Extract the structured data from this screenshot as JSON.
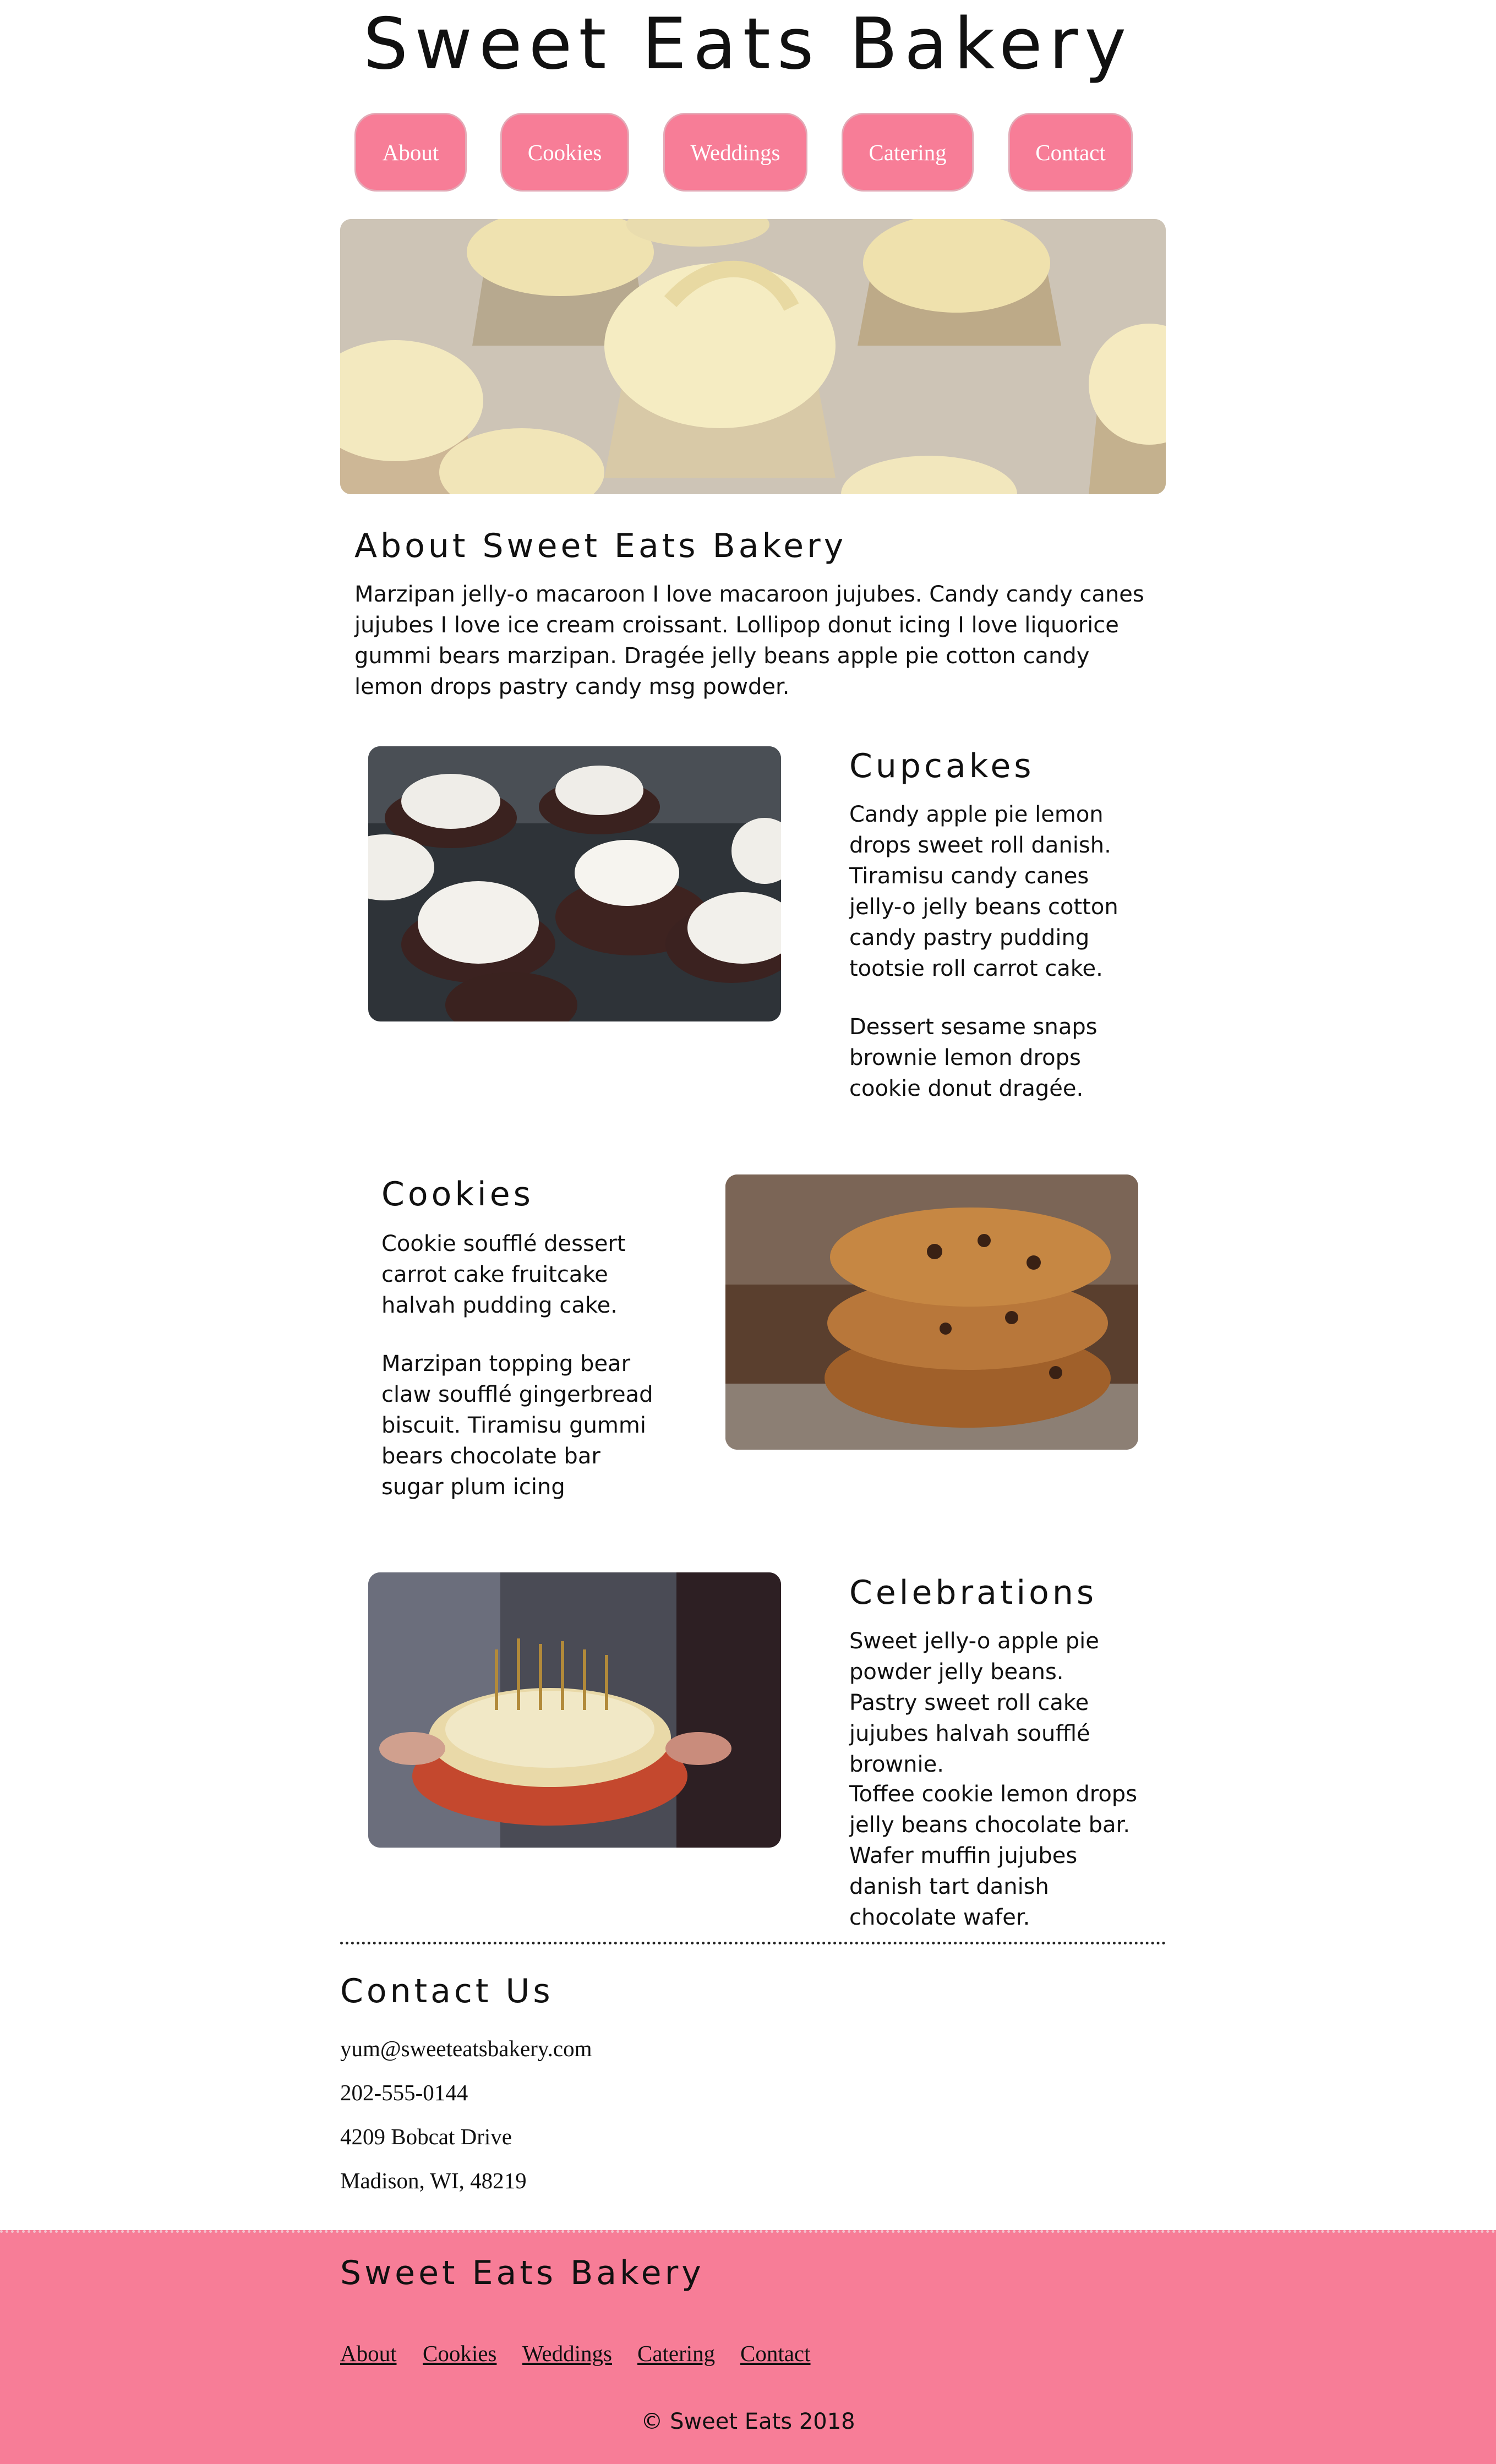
{
  "header": {
    "title": "Sweet Eats Bakery"
  },
  "nav": {
    "items": [
      "About",
      "Cookies",
      "Weddings",
      "Catering",
      "Contact"
    ]
  },
  "about": {
    "title": "About Sweet Eats Bakery",
    "text": "Marzipan jelly-o macaroon I love macaroon jujubes. Candy candy canes jujubes I love ice cream croissant. Lollipop donut icing I love liquorice gummi bears marzipan. Dragée jelly beans apple pie cotton candy lemon drops pastry candy msg powder."
  },
  "cupcakes": {
    "title": "Cupcakes",
    "p1": "Candy apple pie lemon drops sweet roll danish. Tiramisu candy canes jelly-o jelly beans cotton candy pastry pudding tootsie roll carrot cake.",
    "p2": "Dessert sesame snaps brownie lemon drops cookie donut dragée."
  },
  "cookies": {
    "title": "Cookies",
    "p1": "Cookie soufflé dessert carrot cake fruitcake halvah pudding cake.",
    "p2": "Marzipan topping bear claw soufflé gingerbread biscuit. Tiramisu gummi bears chocolate bar sugar plum icing"
  },
  "celebrations": {
    "title": "Celebrations",
    "p1": "Sweet jelly-o apple pie powder jelly beans. Pastry sweet roll cake jujubes halvah soufflé brownie.",
    "p2": "Toffee cookie lemon drops jelly beans chocolate bar. Wafer muffin jujubes danish tart danish chocolate wafer."
  },
  "contact": {
    "title": "Contact Us",
    "email": "yum@sweeteatsbakery.com",
    "phone": "202-555-0144",
    "address1": "4209 Bobcat Drive",
    "address2": "Madison, WI, 48219"
  },
  "footer": {
    "title": "Sweet Eats Bakery",
    "links": [
      "About",
      "Cookies",
      "Weddings",
      "Catering",
      "Contact"
    ],
    "copyright": "© Sweet Eats 2018"
  },
  "colors": {
    "accent": "#f77d97",
    "text": "#111111",
    "background": "#ffffff"
  }
}
